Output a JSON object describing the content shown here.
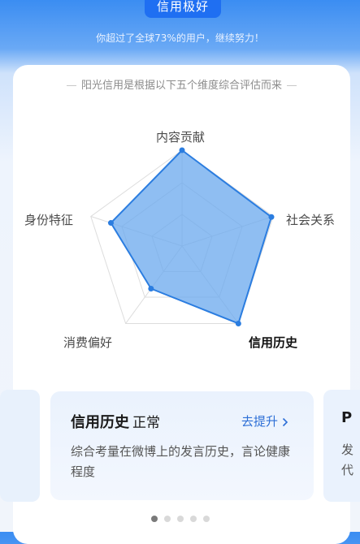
{
  "header": {
    "credit_level": "信用极好",
    "beat_text": "你超过了全球73%的用户，继续努力！"
  },
  "card": {
    "subtitle": "阳光信用是根据以下五个维度综合评估而来"
  },
  "chart_data": {
    "type": "radar",
    "categories": [
      "内容贡献",
      "社会关系",
      "信用历史",
      "消费偏好",
      "身份特征"
    ],
    "values": [
      1.0,
      0.98,
      1.0,
      0.55,
      0.78
    ],
    "rmax": 1,
    "selected": "信用历史",
    "colors": {
      "fill": "#6aa8ee",
      "stroke": "#2b7de0",
      "grid": "#dddddd"
    }
  },
  "detail": {
    "title": "信用历史",
    "status": "正常",
    "improve_link": "去提升",
    "description": "综合考量在微博上的发言历史，言论健康程度"
  },
  "next_peek": {
    "title_fragment": "P",
    "desc_line1": "发",
    "desc_line2": "代"
  },
  "pagination": {
    "total": 5,
    "active": 0
  }
}
